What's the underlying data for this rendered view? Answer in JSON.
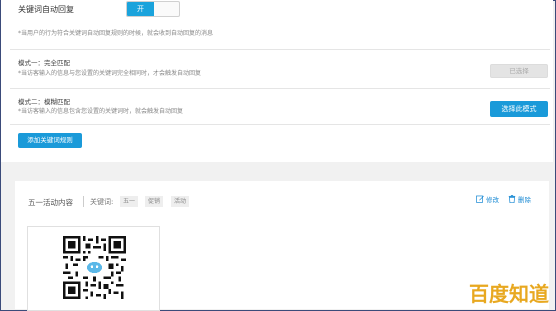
{
  "header": {
    "title": "关键词自动回复",
    "toggle_on_label": "开",
    "hint": "*当用户的行为符合关键词自动回复规则的时候，就会收到自动回复的消息"
  },
  "modes": [
    {
      "title": "模式一：完全匹配",
      "desc": "*当访客输入的信息与您设置的关键词完全相同时，才会触发自动回复",
      "button_label": "已选择"
    },
    {
      "title": "模式二：模糊匹配",
      "desc": "*当访客输入的信息包含您设置的关键词时，就会触发自动回复",
      "button_label": "选择此模式"
    }
  ],
  "add_rule_label": "添加关键词规则",
  "rule_card": {
    "title": "五一活动内容",
    "keyword_label": "关键词:",
    "tags": [
      "五一",
      "促销",
      "活动"
    ],
    "edit_label": "修改",
    "delete_label": "删除"
  },
  "watermark": "百度知道",
  "colors": {
    "accent": "#1a9ad9",
    "toggle_on": "#1aa3dc",
    "watermark": "#e8a820"
  }
}
